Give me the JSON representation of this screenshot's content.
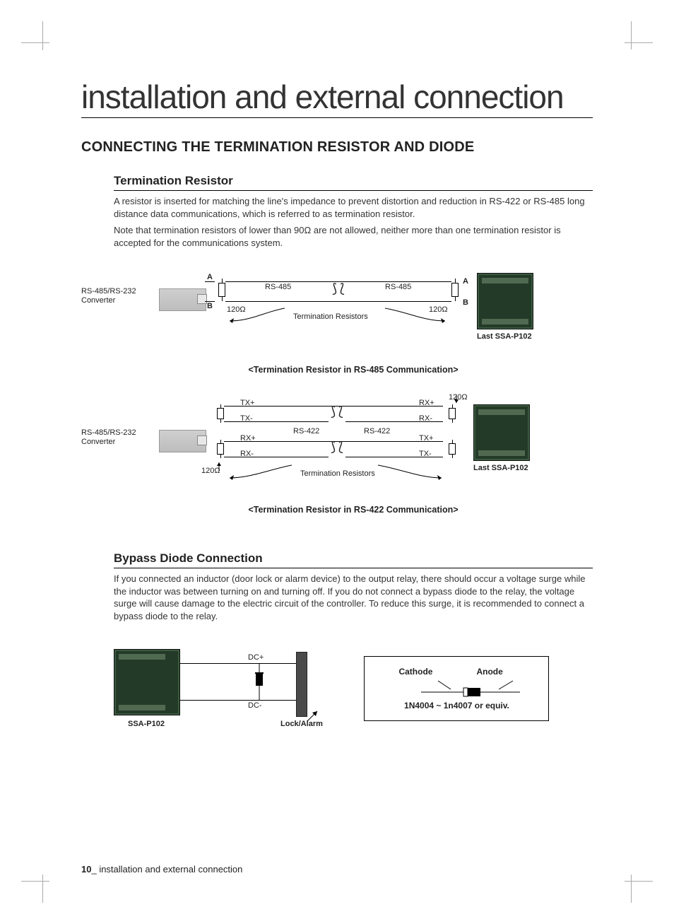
{
  "chapter": "installation and external connection",
  "h1": "CONNECTING THE TERMINATION RESISTOR AND DIODE",
  "term": {
    "h2": "Termination Resistor",
    "p1": "A resistor is inserted for matching the line's impedance to prevent distortion and reduction in RS-422 or RS-485 long distance data communications, which is referred to as termination resistor.",
    "p2": "Note that termination resistors of lower than 90Ω are not allowed, neither more than one termination resistor is accepted for the communications system."
  },
  "diag485": {
    "converter": "RS-485/RS-232 Converter",
    "busL": "RS-485",
    "busR": "RS-485",
    "a": "A",
    "b": "B",
    "r": "120Ω",
    "mid": "Termination Resistors",
    "device": "Last SSA-P102",
    "caption": "<Termination Resistor in RS-485 Communication>"
  },
  "diag422": {
    "converter": "RS-485/RS-232 Converter",
    "busL": "RS-422",
    "busR": "RS-422",
    "txp": "TX+",
    "txm": "TX-",
    "rxp": "RX+",
    "rxm": "RX-",
    "r": "120Ω",
    "mid": "Termination Resistors",
    "device": "Last SSA-P102",
    "caption": "<Termination Resistor in RS-422 Communication>"
  },
  "bypass": {
    "h2": "Bypass Diode Connection",
    "p1": "If you connected an inductor (door lock or alarm device) to the output relay, there should occur a voltage surge while the inductor was between turning on and turning off. If you do not connect a bypass diode to the relay, the voltage surge will cause damage to the electric circuit of the controller. To reduce this surge, it is recommended to connect a bypass diode to the relay.",
    "dcplus": "DC+",
    "dcminus": "DC-",
    "dev": "SSA-P102",
    "lock": "Lock/Alarm",
    "cathode": "Cathode",
    "anode": "Anode",
    "part": "1N4004 ~ 1n4007 or equiv."
  },
  "footer": {
    "num": "10",
    "sep": "_",
    "text": " installation and external connection"
  }
}
